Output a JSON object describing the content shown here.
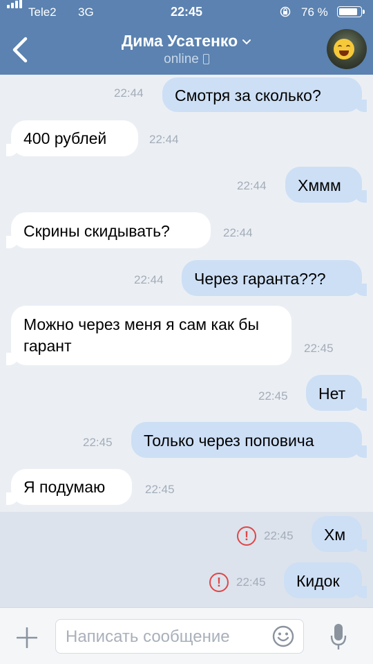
{
  "status_bar": {
    "carrier": "Tele2",
    "network": "3G",
    "time": "22:45",
    "battery": "76 %"
  },
  "header": {
    "name": "Дима Усатенко",
    "status": "online"
  },
  "messages": [
    {
      "dir": "out",
      "text": "Смотря за сколько?",
      "time": "22:44",
      "error": false
    },
    {
      "dir": "in",
      "text": "400 рублей",
      "time": "22:44",
      "error": false
    },
    {
      "dir": "out",
      "text": "Хммм",
      "time": "22:44",
      "error": false
    },
    {
      "dir": "in",
      "text": "Скрины скидывать?",
      "time": "22:44",
      "error": false
    },
    {
      "dir": "out",
      "text": "Через гаранта???",
      "time": "22:44",
      "error": false
    },
    {
      "dir": "in",
      "text": "Можно через меня я сам как бы гарант",
      "time": "22:45",
      "error": false
    },
    {
      "dir": "out",
      "text": "Нет",
      "time": "22:45",
      "error": false
    },
    {
      "dir": "out",
      "text": "Только через поповича",
      "time": "22:45",
      "error": false
    },
    {
      "dir": "in",
      "text": "Я подумаю",
      "time": "22:45",
      "error": false
    },
    {
      "dir": "out",
      "text": "Хм",
      "time": "22:45",
      "error": true
    },
    {
      "dir": "out",
      "text": "Кидок",
      "time": "22:45",
      "error": true
    }
  ],
  "composer": {
    "placeholder": "Написать сообщение"
  },
  "colors": {
    "header_bg": "#5b82b0",
    "outgoing_bubble": "#cddff5",
    "incoming_bubble": "#ffffff",
    "error": "#e04646"
  },
  "icons": [
    "signal-icon",
    "lock-rotation-icon",
    "battery-icon",
    "back-chevron-icon",
    "chevron-down-icon",
    "phone-icon",
    "avatar",
    "error-icon",
    "plus-icon",
    "smile-icon",
    "mic-icon"
  ]
}
